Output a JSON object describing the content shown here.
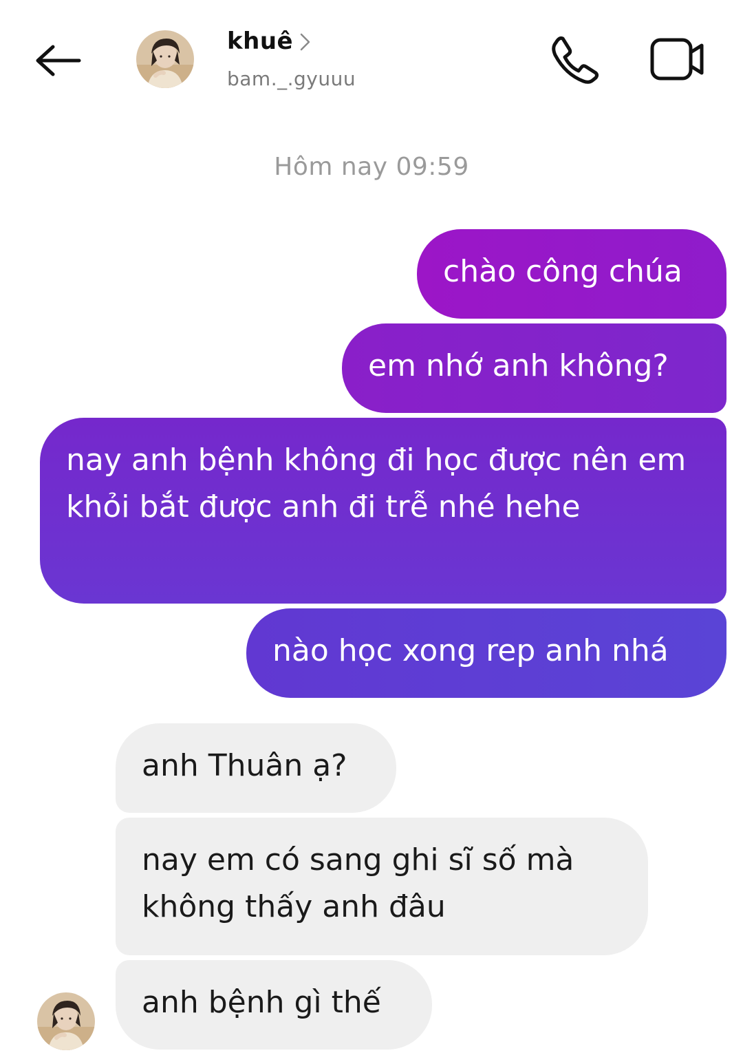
{
  "header": {
    "back_icon": "arrow-left-icon",
    "contact_name": "khuê",
    "contact_handle": "bam._.gyuuu",
    "chevron_icon": "chevron-right-icon",
    "call_icon": "phone-icon",
    "video_icon": "video-camera-icon",
    "avatar": "profile-photo"
  },
  "thread": {
    "timestamp": "Hôm nay 09:59",
    "messages": [
      {
        "direction": "outgoing",
        "text": "chào công chúa"
      },
      {
        "direction": "outgoing",
        "text": "em nhớ anh không?"
      },
      {
        "direction": "outgoing",
        "text": "nay anh bệnh không đi học được nên em khỏi bắt được anh đi trễ nhé hehe"
      },
      {
        "direction": "outgoing",
        "text": "nào học xong rep anh nhá"
      },
      {
        "direction": "incoming",
        "text": "anh Thuân ạ?"
      },
      {
        "direction": "incoming",
        "text": "nay em có sang ghi sĩ số mà không thấy anh đâu"
      },
      {
        "direction": "incoming",
        "text": "anh bệnh gì thế"
      }
    ]
  },
  "colors": {
    "outgoing_gradient_start": "#9c16c7",
    "outgoing_gradient_end": "#5a44d6",
    "incoming_bubble": "#efefef",
    "timestamp_text": "#9a9a9a"
  }
}
